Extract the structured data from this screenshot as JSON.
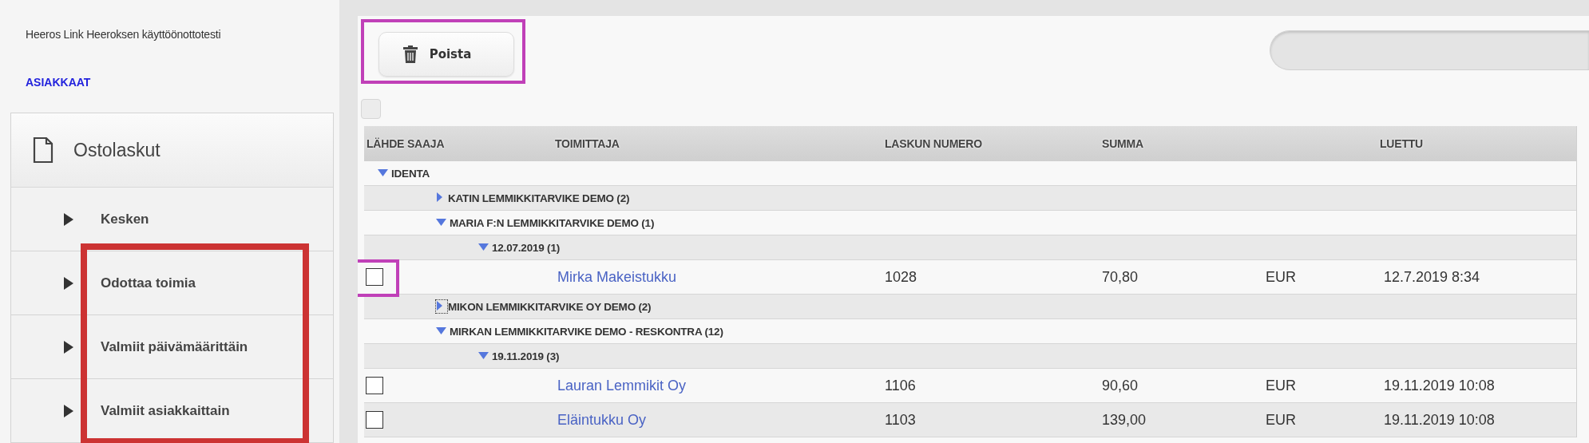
{
  "sidebar": {
    "account": "Heeros Link Heeroksen käyttöönottotesti",
    "link": "ASIAKKAAT",
    "section": {
      "title": "Ostolaskut"
    },
    "items": [
      {
        "label": "Kesken",
        "highlighted": false
      },
      {
        "label": "Odottaa toimia",
        "highlighted": true
      },
      {
        "label": "Valmiit päivämäärittäin",
        "highlighted": true
      },
      {
        "label": "Valmiit asiakkaittain",
        "highlighted": true
      }
    ]
  },
  "toolbar": {
    "delete_button": {
      "label": "Poista",
      "highlighted": true
    }
  },
  "table": {
    "select_all": {
      "checked": false
    },
    "columns": [
      "LÄHDE SAAJA",
      "TOIMITTAJA",
      "LASKUN NUMERO",
      "SUMMA",
      "LUETTU"
    ],
    "tree": [
      {
        "kind": "group",
        "label": "IDENTA",
        "expanded": true,
        "focused": false,
        "children": [
          {
            "kind": "group",
            "label": "KATIN LEMMIKKITARVIKE DEMO (2)",
            "expanded": false,
            "focused": false
          },
          {
            "kind": "group",
            "label": "MARIA F:N LEMMIKKITARVIKE DEMO (1)",
            "expanded": true,
            "focused": false,
            "children": [
              {
                "kind": "group",
                "label": "12.07.2019 (1)",
                "expanded": true,
                "focused": false,
                "children": [
                  {
                    "kind": "invoice",
                    "checked": false,
                    "highlighted": true,
                    "supplier": "Mirka Makeistukku",
                    "number": "1028",
                    "sum": "70,80",
                    "currency": "EUR",
                    "read": "12.7.2019 8:34"
                  }
                ]
              }
            ]
          },
          {
            "kind": "group",
            "label": "MIKON LEMMIKKITARVIKE OY DEMO (2)",
            "expanded": false,
            "focused": true
          },
          {
            "kind": "group",
            "label": "MIRKAN LEMMIKKITARVIKE DEMO - RESKONTRA (12)",
            "expanded": true,
            "focused": false,
            "children": [
              {
                "kind": "group",
                "label": "19.11.2019 (3)",
                "expanded": true,
                "focused": false,
                "children": [
                  {
                    "kind": "invoice",
                    "checked": false,
                    "highlighted": false,
                    "supplier": "Lauran Lemmikit Oy",
                    "number": "1106",
                    "sum": "90,60",
                    "currency": "EUR",
                    "read": "19.11.2019 10:08"
                  },
                  {
                    "kind": "invoice",
                    "checked": false,
                    "highlighted": false,
                    "supplier": "Eläintukku Oy",
                    "number": "1103",
                    "sum": "139,00",
                    "currency": "EUR",
                    "read": "19.11.2019 10:08"
                  }
                ]
              }
            ]
          }
        ]
      }
    ]
  }
}
